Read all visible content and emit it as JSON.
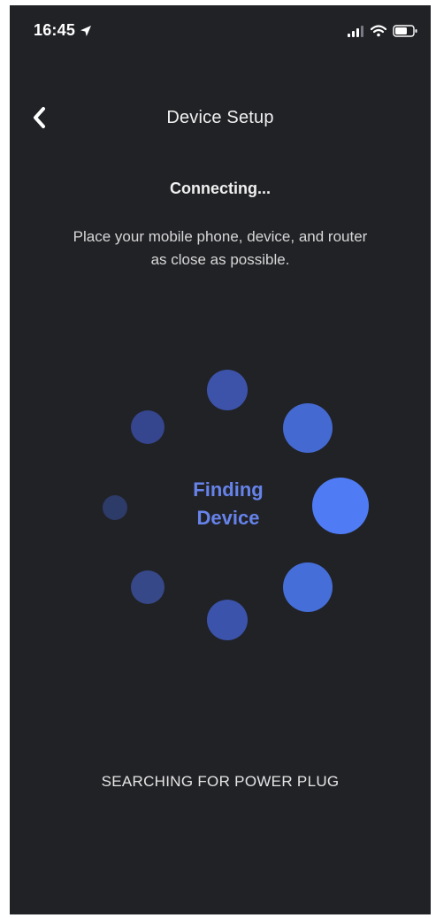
{
  "status_bar": {
    "time": "16:45",
    "icons": [
      "location-arrow-icon",
      "signal-icon",
      "wifi-icon",
      "battery-icon"
    ]
  },
  "nav": {
    "back_icon": "chevron-left-icon",
    "title": "Device Setup"
  },
  "content": {
    "heading": "Connecting...",
    "instruction_line_1": "Place your mobile phone, device, and router",
    "instruction_line_2": "as close as possible.",
    "spinner_label_line_1": "Finding",
    "spinner_label_line_2": "Device",
    "footer_status": "SEARCHING FOR POWER PLUG"
  },
  "colors": {
    "background": "#212226",
    "spinner_text": "#6683ea",
    "dot_dim": "#35458e",
    "dot_mid": "#3f59b0",
    "dot_bright": "#4f7cf4"
  }
}
